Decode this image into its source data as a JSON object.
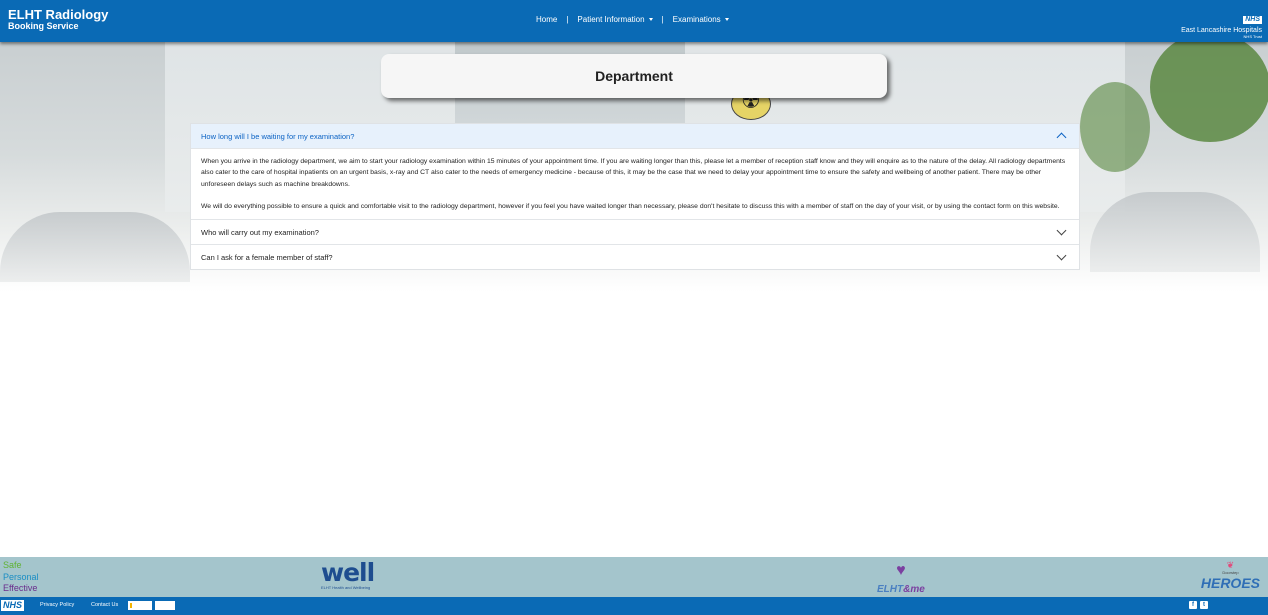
{
  "header": {
    "brand_title": "ELHT Radiology",
    "brand_subtitle": "Booking Service",
    "nav": {
      "home": "Home",
      "separator": "|",
      "patient_information": "Patient Information",
      "examinations": "Examinations"
    },
    "org": {
      "nhs": "NHS",
      "name": "East Lancashire Hospitals",
      "trust": "NHS Trust"
    }
  },
  "page": {
    "title": "Department"
  },
  "accordion": {
    "items": [
      {
        "question": "How long will I be waiting for my examination?",
        "expanded": true,
        "paragraphs": [
          "When you arrive in the radiology department, we aim to start your radiology examination within 15 minutes of your appointment time. If you are waiting longer than this, please let a member of reception staff know and they will enquire as to the nature of the delay. All radiology departments also cater to the care of hospital inpatients on an urgent basis, x-ray and CT also cater to the needs of emergency medicine - because of this, it may be the case that we need to delay your appointment time to ensure the safety and wellbeing of another patient. There may be other unforeseen delays such as machine breakdowns.",
          "We will do everything possible to ensure a quick and comfortable visit to the radiology department, however if you feel you have waited longer than necessary, please don't hesitate to discuss this with a member of staff on the day of your visit, or by using the contact form on this website."
        ]
      },
      {
        "question": "Who will carry out my examination?",
        "expanded": false
      },
      {
        "question": "Can I ask for a female member of staff?",
        "expanded": false
      }
    ]
  },
  "footer": {
    "values": {
      "safe": "Safe",
      "personal": "Personal",
      "effective": "Effective"
    },
    "well": {
      "word": "well",
      "subtitle": "ELHT Health and Wellbeing"
    },
    "elhtme": {
      "text": "ELHT",
      "amp": "&me"
    },
    "heroes": {
      "top": "Doorstep",
      "word": "HEROES"
    },
    "nhs": "NHS",
    "privacy_policy": "Privacy Policy",
    "contact_us": "Contact Us",
    "social": {
      "facebook": "f",
      "twitter": "t"
    },
    "icons": [
      "facebook-icon",
      "twitter-icon",
      "chevron-down-icon",
      "chevron-up-icon",
      "caret-down-icon",
      "radiation-icon"
    ]
  },
  "colors": {
    "header_blue": "#0a6ab5",
    "accordion_active_bg": "#e7f1fc",
    "accordion_active_text": "#0c63c4",
    "footer_band": "#a4c5cc"
  }
}
